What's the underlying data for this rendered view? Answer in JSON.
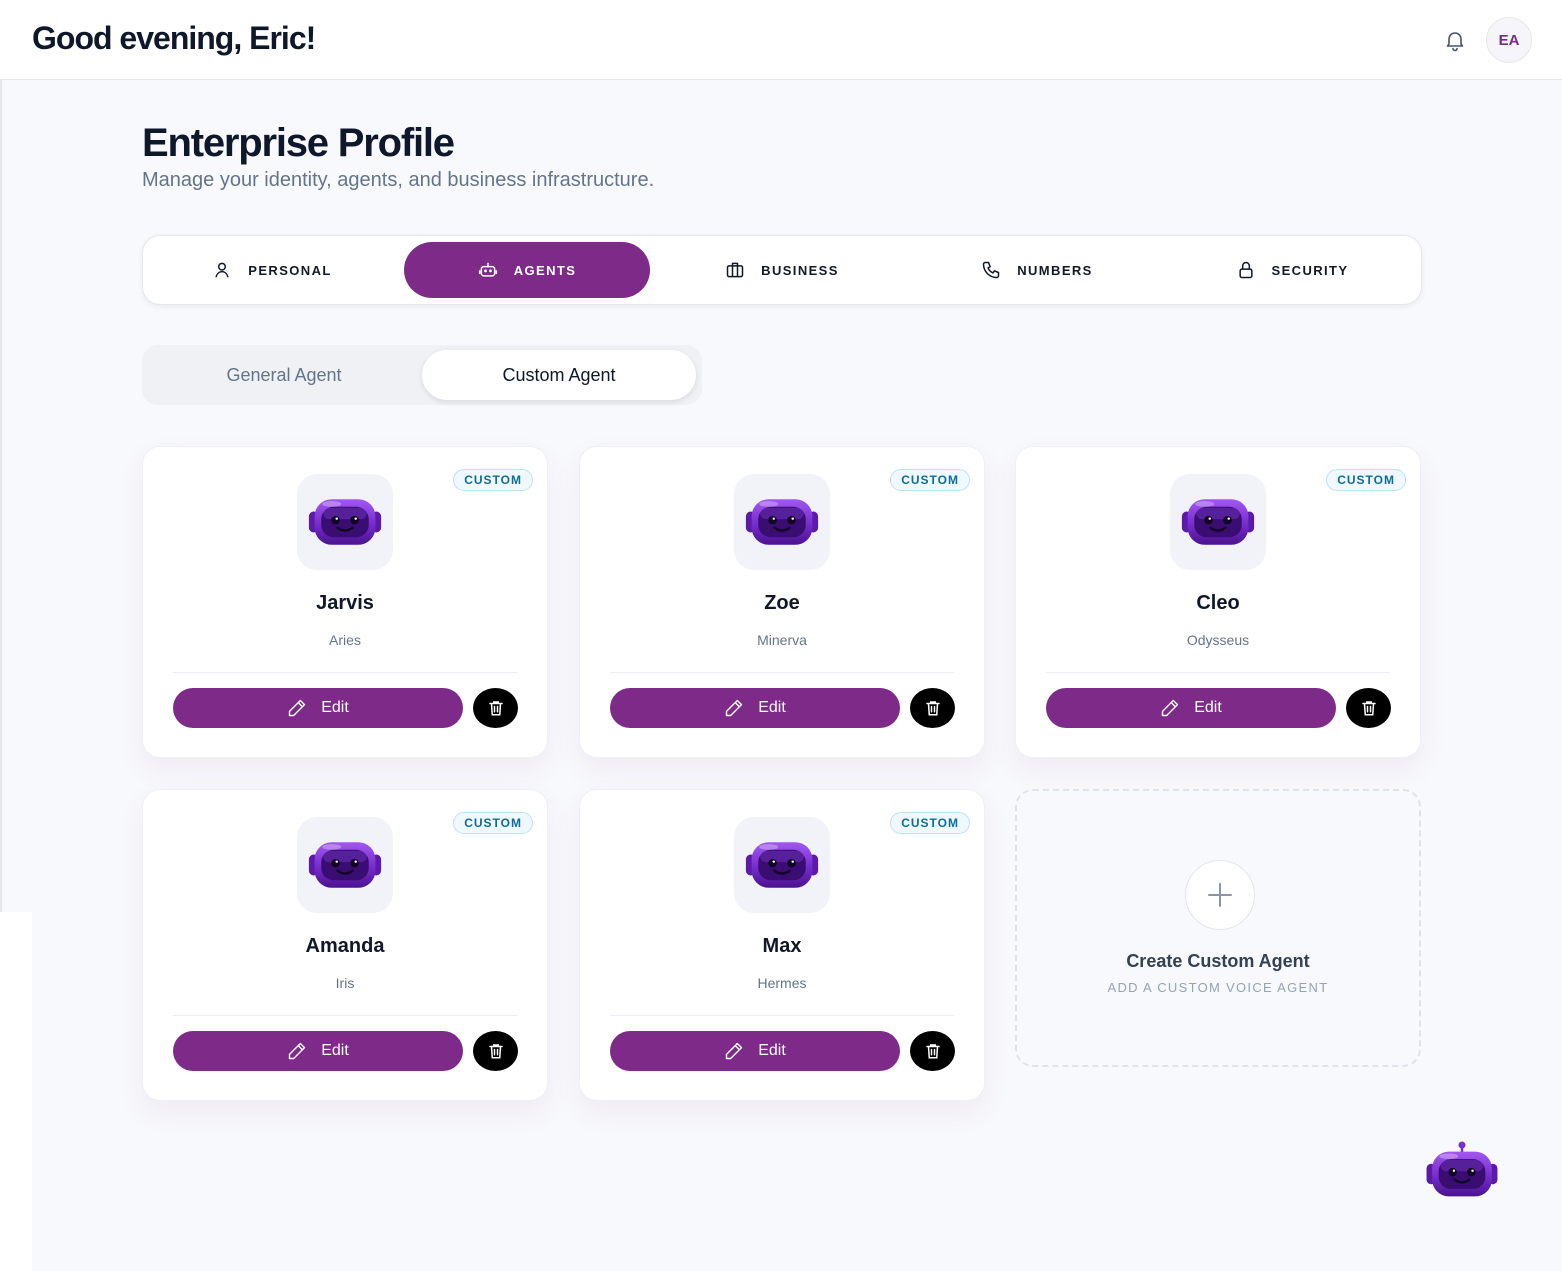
{
  "header": {
    "greeting": "Good evening, Eric!",
    "avatar_initials": "EA",
    "notification_icon": "bell-icon"
  },
  "page": {
    "title": "Enterprise Profile",
    "subtitle": "Manage your identity, agents, and business infrastructure."
  },
  "tabs": [
    {
      "label": "PERSONAL",
      "icon": "user-icon",
      "active": false
    },
    {
      "label": "AGENTS",
      "icon": "robot-icon",
      "active": true
    },
    {
      "label": "BUSINESS",
      "icon": "briefcase-icon",
      "active": false
    },
    {
      "label": "NUMBERS",
      "icon": "phone-icon",
      "active": false
    },
    {
      "label": "SECURITY",
      "icon": "lock-icon",
      "active": false
    }
  ],
  "agent_type_toggle": {
    "options": [
      "General Agent",
      "Custom Agent"
    ],
    "selected": "Custom Agent"
  },
  "agents": [
    {
      "name": "Jarvis",
      "voice": "Aries",
      "badge": "CUSTOM",
      "edit_label": "Edit"
    },
    {
      "name": "Zoe",
      "voice": "Minerva",
      "badge": "CUSTOM",
      "edit_label": "Edit"
    },
    {
      "name": "Cleo",
      "voice": "Odysseus",
      "badge": "CUSTOM",
      "edit_label": "Edit"
    },
    {
      "name": "Amanda",
      "voice": "Iris",
      "badge": "CUSTOM",
      "edit_label": "Edit"
    },
    {
      "name": "Max",
      "voice": "Hermes",
      "badge": "CUSTOM",
      "edit_label": "Edit"
    }
  ],
  "create_card": {
    "title": "Create Custom Agent",
    "subtitle": "ADD A CUSTOM VOICE AGENT"
  },
  "colors": {
    "accent": "#7e2a88",
    "badge_text": "#0e6c97",
    "background": "#f8f9fc"
  }
}
